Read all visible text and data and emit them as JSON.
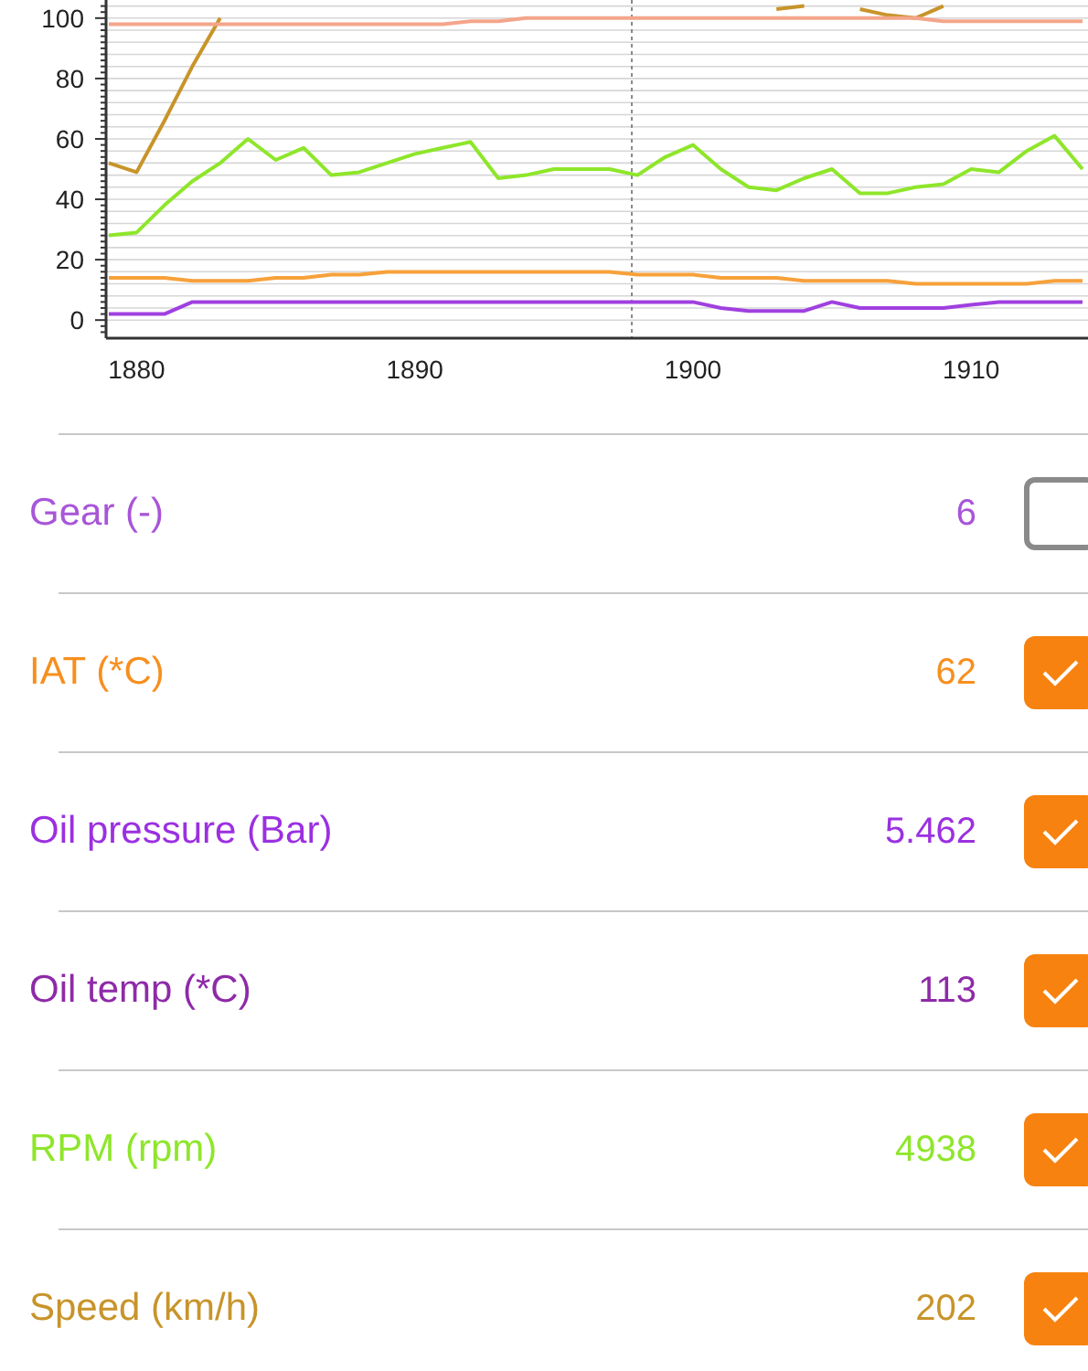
{
  "chart": {
    "chart_data": {
      "type": "line",
      "x": [
        1879,
        1880,
        1881,
        1882,
        1883,
        1884,
        1885,
        1886,
        1887,
        1888,
        1889,
        1890,
        1891,
        1892,
        1893,
        1894,
        1895,
        1896,
        1897,
        1898,
        1899,
        1900,
        1901,
        1902,
        1903,
        1904,
        1905,
        1906,
        1907,
        1908,
        1909,
        1910,
        1911,
        1912,
        1913,
        1914
      ],
      "series": [
        {
          "color": "#c8942a",
          "values": [
            52,
            49,
            66,
            84,
            100,
            null,
            null,
            null,
            null,
            null,
            null,
            null,
            null,
            null,
            null,
            null,
            null,
            null,
            null,
            null,
            null,
            null,
            null,
            null,
            103,
            104,
            null,
            103,
            101,
            100,
            104,
            null,
            null,
            null,
            null,
            null
          ]
        },
        {
          "color": "#f4a58a",
          "values": [
            98,
            98,
            98,
            98,
            98,
            98,
            98,
            98,
            98,
            98,
            98,
            98,
            98,
            99,
            99,
            100,
            100,
            100,
            100,
            100,
            100,
            100,
            100,
            100,
            100,
            100,
            100,
            100,
            100,
            100,
            99,
            99,
            99,
            99,
            99,
            99
          ]
        },
        {
          "color": "#8ee62a",
          "values": [
            28,
            29,
            38,
            46,
            52,
            60,
            53,
            57,
            48,
            49,
            52,
            55,
            57,
            59,
            47,
            48,
            50,
            50,
            50,
            48,
            54,
            58,
            50,
            44,
            43,
            47,
            50,
            42,
            42,
            44,
            45,
            50,
            49,
            56,
            61,
            50
          ]
        },
        {
          "color": "#f7a13a",
          "values": [
            14,
            14,
            14,
            13,
            13,
            13,
            14,
            14,
            15,
            15,
            16,
            16,
            16,
            16,
            16,
            16,
            16,
            16,
            16,
            15,
            15,
            15,
            14,
            14,
            14,
            13,
            13,
            13,
            13,
            12,
            12,
            12,
            12,
            12,
            13,
            13
          ]
        },
        {
          "color": "#a040e0",
          "values": [
            2,
            2,
            2,
            6,
            6,
            6,
            6,
            6,
            6,
            6,
            6,
            6,
            6,
            6,
            6,
            6,
            6,
            6,
            6,
            6,
            6,
            6,
            4,
            3,
            3,
            3,
            6,
            4,
            4,
            4,
            4,
            5,
            6,
            6,
            6,
            6
          ]
        }
      ],
      "grid": true,
      "ref_lines": [
        {
          "axis": "x",
          "value": 1897.8
        }
      ],
      "xlim": [
        1878.9,
        1914.2
      ],
      "ylim": [
        -6,
        106
      ],
      "xticks": [
        1880,
        1890,
        1900,
        1910
      ],
      "yticks": [
        0,
        20,
        40,
        60,
        80,
        100
      ]
    }
  },
  "channels": [
    {
      "name": "Gear (-)",
      "value": "6",
      "color": "#a855d8",
      "checked": false
    },
    {
      "name": "IAT (*C)",
      "value": "62",
      "color": "#f78f1e",
      "checked": true
    },
    {
      "name": "Oil pressure (Bar)",
      "value": "5.462",
      "color": "#9b30e0",
      "checked": true
    },
    {
      "name": "Oil temp (*C)",
      "value": "113",
      "color": "#8e2aa8",
      "checked": true
    },
    {
      "name": "RPM (rpm)",
      "value": "4938",
      "color": "#8ee62a",
      "checked": true
    },
    {
      "name": "Speed (km/h)",
      "value": "202",
      "color": "#c8942a",
      "checked": true
    }
  ]
}
